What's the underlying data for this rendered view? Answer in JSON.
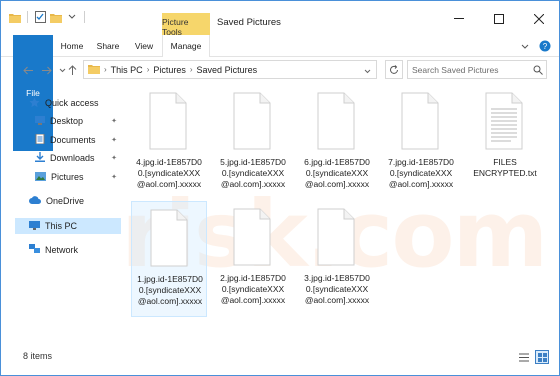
{
  "window": {
    "title": "Saved Pictures",
    "context_tab": "Picture Tools"
  },
  "ribbon": {
    "tabs": [
      "File",
      "Home",
      "Share",
      "View",
      "Manage"
    ]
  },
  "address": {
    "crumbs": [
      "This PC",
      "Pictures",
      "Saved Pictures"
    ]
  },
  "search": {
    "placeholder": "Search Saved Pictures"
  },
  "nav": {
    "quick_access": "Quick access",
    "items": [
      "Desktop",
      "Documents",
      "Downloads",
      "Pictures"
    ],
    "onedrive": "OneDrive",
    "this_pc": "This PC",
    "network": "Network"
  },
  "files": [
    {
      "name": "4.jpg.id-1E857D0\n0.[syndicateXXX\n@aol.com].xxxxx"
    },
    {
      "name": "5.jpg.id-1E857D0\n0.[syndicateXXX\n@aol.com].xxxxx"
    },
    {
      "name": "6.jpg.id-1E857D0\n0.[syndicateXXX\n@aol.com].xxxxx"
    },
    {
      "name": "7.jpg.id-1E857D0\n0.[syndicateXXX\n@aol.com].xxxxx"
    },
    {
      "name": "FILES\nENCRYPTED.txt"
    },
    {
      "name": "1.jpg.id-1E857D0\n0.[syndicateXXX\n@aol.com].xxxxx"
    },
    {
      "name": "2.jpg.id-1E857D0\n0.[syndicateXXX\n@aol.com].xxxxx"
    },
    {
      "name": "3.jpg.id-1E857D0\n0.[syndicateXXX\n@aol.com].xxxxx"
    }
  ],
  "status": {
    "count": "8 items"
  },
  "colors": {
    "accent": "#1979ca",
    "context_tab": "#f6d66b",
    "selection": "#cce8ff"
  }
}
